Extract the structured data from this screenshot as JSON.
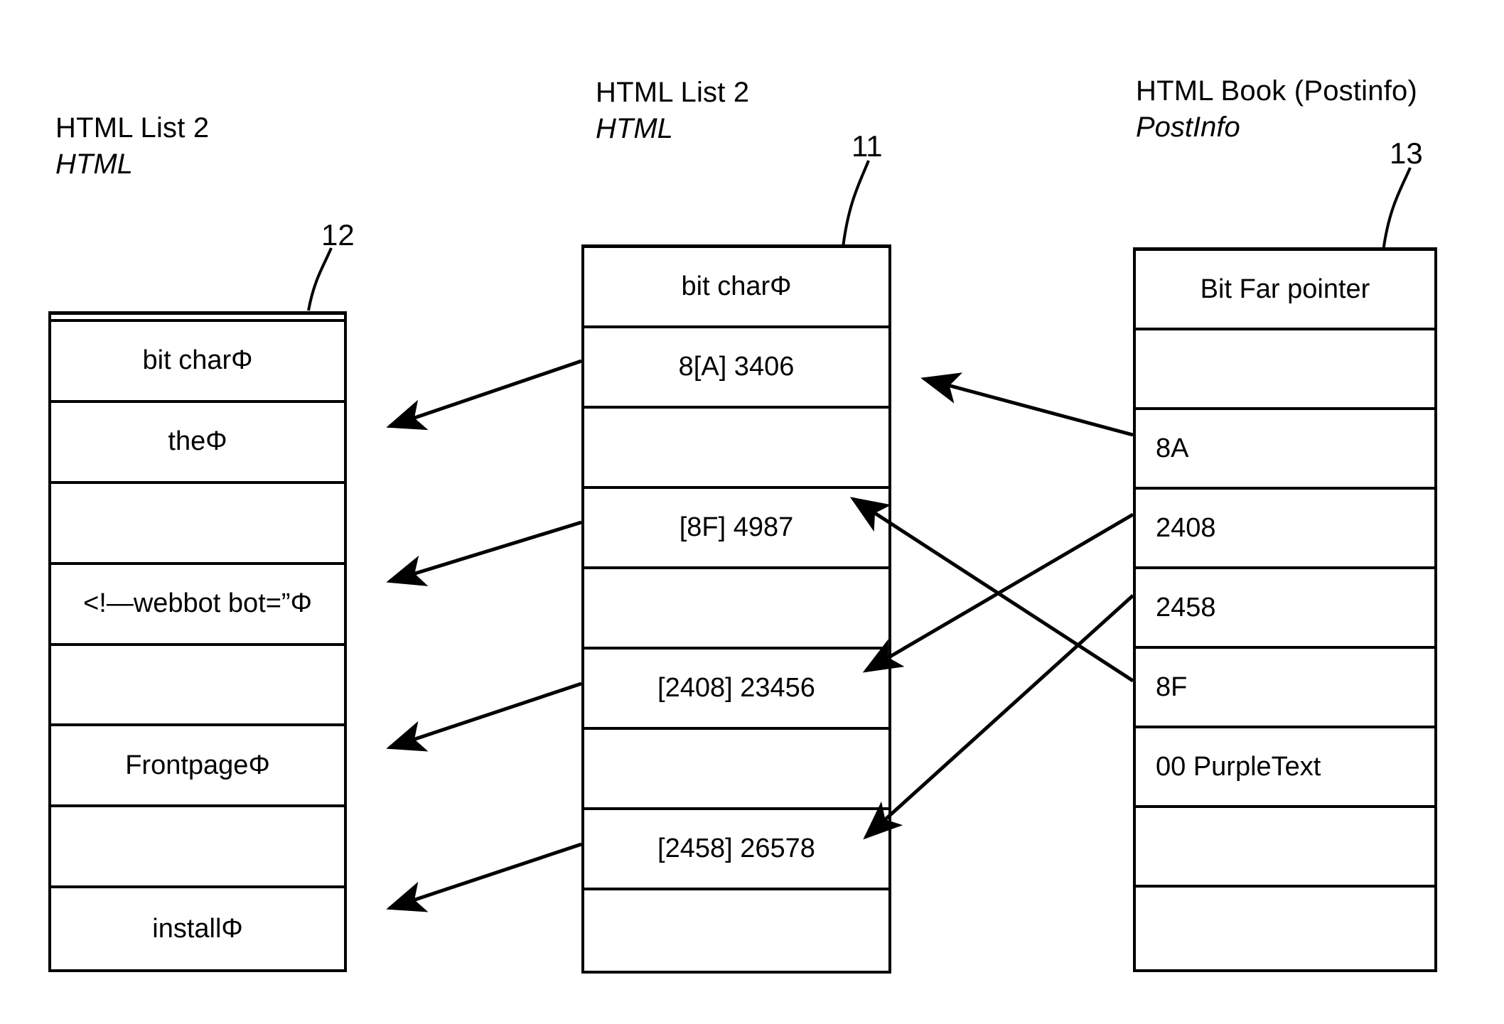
{
  "diagram": {
    "figure_type": "patent-figure",
    "columns": [
      {
        "id": "html-list-2-left",
        "ref": "12",
        "header_main": "HTML List 2",
        "header_sub": "HTML",
        "align": "center",
        "rows": [
          {
            "text": "bit charΦ"
          },
          {
            "text": "theΦ"
          },
          {
            "text": ""
          },
          {
            "text": "<!—webbot bot=”Φ"
          },
          {
            "text": ""
          },
          {
            "text": "FrontpageΦ"
          },
          {
            "text": ""
          },
          {
            "text": "installΦ"
          }
        ]
      },
      {
        "id": "html-list-2-mid",
        "ref": "11",
        "header_main": "HTML List 2",
        "header_sub": "HTML",
        "align": "center",
        "rows": [
          {
            "text": "bit charΦ"
          },
          {
            "text": "8[A] 3406"
          },
          {
            "text": ""
          },
          {
            "text": "[8F] 4987"
          },
          {
            "text": ""
          },
          {
            "text": "[2408] 23456"
          },
          {
            "text": ""
          },
          {
            "text": "[2458] 26578"
          },
          {
            "text": ""
          }
        ]
      },
      {
        "id": "html-book-postinfo",
        "ref": "13",
        "header_main": "HTML Book (Postinfo)",
        "header_sub": "PostInfo",
        "align": "left",
        "rows": [
          {
            "text": "Bit Far pointer",
            "align": "center"
          },
          {
            "text": ""
          },
          {
            "text": "8A"
          },
          {
            "text": "2408"
          },
          {
            "text": "2458"
          },
          {
            "text": "8F"
          },
          {
            "text": "00 PurpleText"
          },
          {
            "text": ""
          },
          {
            "text": ""
          }
        ]
      }
    ],
    "colors": {
      "stroke": "#000000",
      "background": "#ffffff"
    },
    "arrows": [
      {
        "name": "mid-row2-to-left-row2",
        "from": "mid [8[A] 3406]",
        "to": "left [theΦ]"
      },
      {
        "name": "mid-row4-to-left-row4",
        "from": "mid [[8F] 4987]",
        "to": "left [<!—webbot bot=”Φ]"
      },
      {
        "name": "mid-row6-to-left-row6",
        "from": "mid [[2408] 23456]",
        "to": "left [FrontpageΦ]"
      },
      {
        "name": "mid-row8-to-left-row8",
        "from": "mid [[2458] 26578]",
        "to": "left [installΦ]"
      },
      {
        "name": "right-8a-to-mid-row2",
        "from": "right [8A]",
        "to": "mid [8[A] 3406]"
      },
      {
        "name": "right-8f-to-mid-row4",
        "from": "right [8F]",
        "to": "mid [[8F] 4987]"
      },
      {
        "name": "right-2408-to-mid-row6",
        "from": "right [2408]",
        "to": "mid [[2408] 23456]"
      },
      {
        "name": "right-2458-to-mid-row8",
        "from": "right [2458]",
        "to": "mid [[2458] 26578]"
      }
    ]
  }
}
